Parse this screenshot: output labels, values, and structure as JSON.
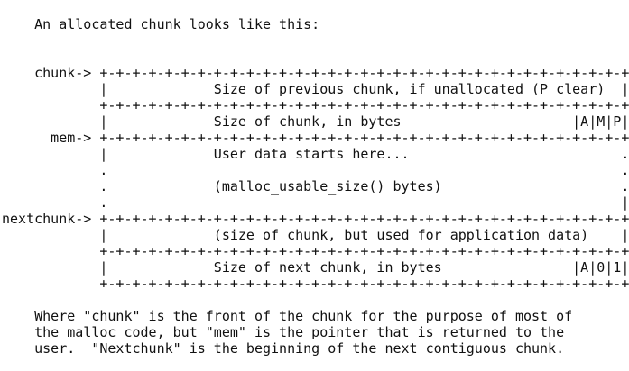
{
  "intro": "    An allocated chunk looks like this:",
  "diagram": {
    "rows": [
      "    chunk-> +-+-+-+-+-+-+-+-+-+-+-+-+-+-+-+-+-+-+-+-+-+-+-+-+-+-+-+-+-+-+-+-+",
      "            |             Size of previous chunk, if unallocated (P clear)  |",
      "            +-+-+-+-+-+-+-+-+-+-+-+-+-+-+-+-+-+-+-+-+-+-+-+-+-+-+-+-+-+-+-+-+",
      "            |             Size of chunk, in bytes                     |A|M|P|",
      "      mem-> +-+-+-+-+-+-+-+-+-+-+-+-+-+-+-+-+-+-+-+-+-+-+-+-+-+-+-+-+-+-+-+-+",
      "            |             User data starts here...                          .",
      "            .                                                               .",
      "            .             (malloc_usable_size() bytes)                      .",
      "            .                                                               |",
      "nextchunk-> +-+-+-+-+-+-+-+-+-+-+-+-+-+-+-+-+-+-+-+-+-+-+-+-+-+-+-+-+-+-+-+-+",
      "            |             (size of chunk, but used for application data)    |",
      "            +-+-+-+-+-+-+-+-+-+-+-+-+-+-+-+-+-+-+-+-+-+-+-+-+-+-+-+-+-+-+-+-+",
      "            |             Size of next chunk, in bytes                |A|0|1|",
      "            +-+-+-+-+-+-+-+-+-+-+-+-+-+-+-+-+-+-+-+-+-+-+-+-+-+-+-+-+-+-+-+-+"
    ]
  },
  "explanation": [
    "    Where \"chunk\" is the front of the chunk for the purpose of most of",
    "    the malloc code, but \"mem\" is the pointer that is returned to the",
    "    user.  \"Nextchunk\" is the beginning of the next contiguous chunk."
  ]
}
